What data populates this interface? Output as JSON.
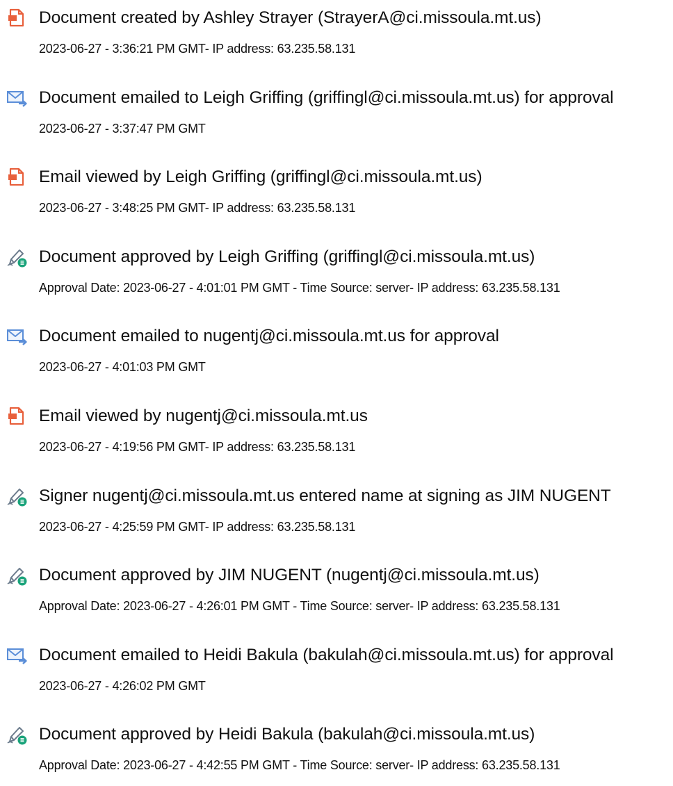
{
  "colors": {
    "text": "#111111",
    "document_icon": "#e8603c",
    "email_icon": "#5b8ed8",
    "approval_icon_pen": "#6b7b8c",
    "approval_icon_badge": "#1aa37a"
  },
  "events": [
    {
      "icon": "document-icon",
      "title": "Document created by Ashley Strayer (StrayerA@ci.missoula.mt.us)",
      "detail": "2023-06-27 - 3:36:21 PM GMT- IP address: 63.235.58.131"
    },
    {
      "icon": "email-sent-icon",
      "title": "Document emailed to Leigh Griffing (griffingl@ci.missoula.mt.us) for approval",
      "detail": "2023-06-27 - 3:37:47 PM GMT"
    },
    {
      "icon": "document-icon",
      "title": "Email viewed by Leigh Griffing (griffingl@ci.missoula.mt.us)",
      "detail": "2023-06-27 - 3:48:25 PM GMT- IP address: 63.235.58.131"
    },
    {
      "icon": "approval-pen-icon",
      "title": "Document approved by Leigh Griffing (griffingl@ci.missoula.mt.us)",
      "detail": "Approval Date: 2023-06-27 - 4:01:01 PM GMT - Time Source: server- IP address: 63.235.58.131"
    },
    {
      "icon": "email-sent-icon",
      "title": "Document emailed to nugentj@ci.missoula.mt.us for approval",
      "detail": "2023-06-27 - 4:01:03 PM GMT"
    },
    {
      "icon": "document-icon",
      "title": "Email viewed by nugentj@ci.missoula.mt.us",
      "detail": "2023-06-27 - 4:19:56 PM GMT- IP address: 63.235.58.131"
    },
    {
      "icon": "approval-pen-icon",
      "title": "Signer nugentj@ci.missoula.mt.us entered name at signing as JIM NUGENT",
      "detail": "2023-06-27 - 4:25:59 PM GMT- IP address: 63.235.58.131"
    },
    {
      "icon": "approval-pen-icon",
      "title": "Document approved by JIM NUGENT (nugentj@ci.missoula.mt.us)",
      "detail": "Approval Date: 2023-06-27 - 4:26:01 PM GMT - Time Source: server- IP address: 63.235.58.131"
    },
    {
      "icon": "email-sent-icon",
      "title": "Document emailed to Heidi Bakula (bakulah@ci.missoula.mt.us) for approval",
      "detail": "2023-06-27 - 4:26:02 PM GMT"
    },
    {
      "icon": "approval-pen-icon",
      "title": "Document approved by Heidi Bakula (bakulah@ci.missoula.mt.us)",
      "detail": "Approval Date: 2023-06-27 - 4:42:55 PM GMT - Time Source: server- IP address: 63.235.58.131"
    }
  ]
}
